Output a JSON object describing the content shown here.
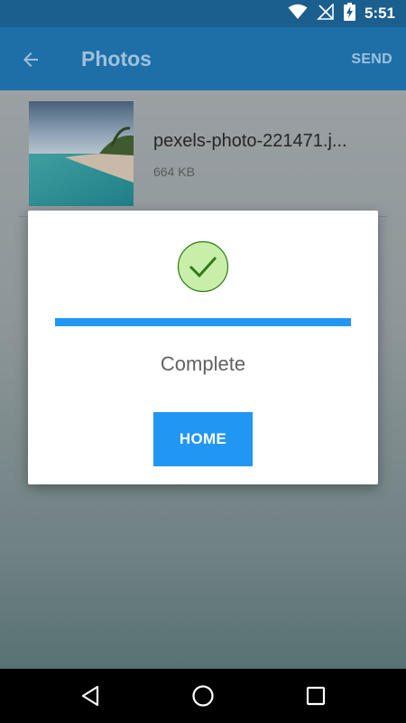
{
  "status_bar": {
    "time": "5:51",
    "icons": [
      "wifi-icon",
      "no-signal-icon",
      "battery-charging-icon"
    ]
  },
  "app_bar": {
    "title": "Photos",
    "send_label": "SEND",
    "back_icon": "arrow-back-icon"
  },
  "file": {
    "name": "pexels-photo-221471.j...",
    "size": "664 KB"
  },
  "dialog": {
    "status_icon": "check-circle-icon",
    "progress": 1.0,
    "message": "Complete",
    "home_label": "HOME"
  },
  "nav_bar": {
    "buttons": [
      "back-triangle-icon",
      "home-circle-icon",
      "recents-square-icon"
    ]
  },
  "colors": {
    "app_bar": "#1e6fa8",
    "status_bar": "#1a5f8e",
    "accent": "#2196f3",
    "check_fill": "#c8eeaa",
    "check_stroke": "#2e7d13"
  }
}
